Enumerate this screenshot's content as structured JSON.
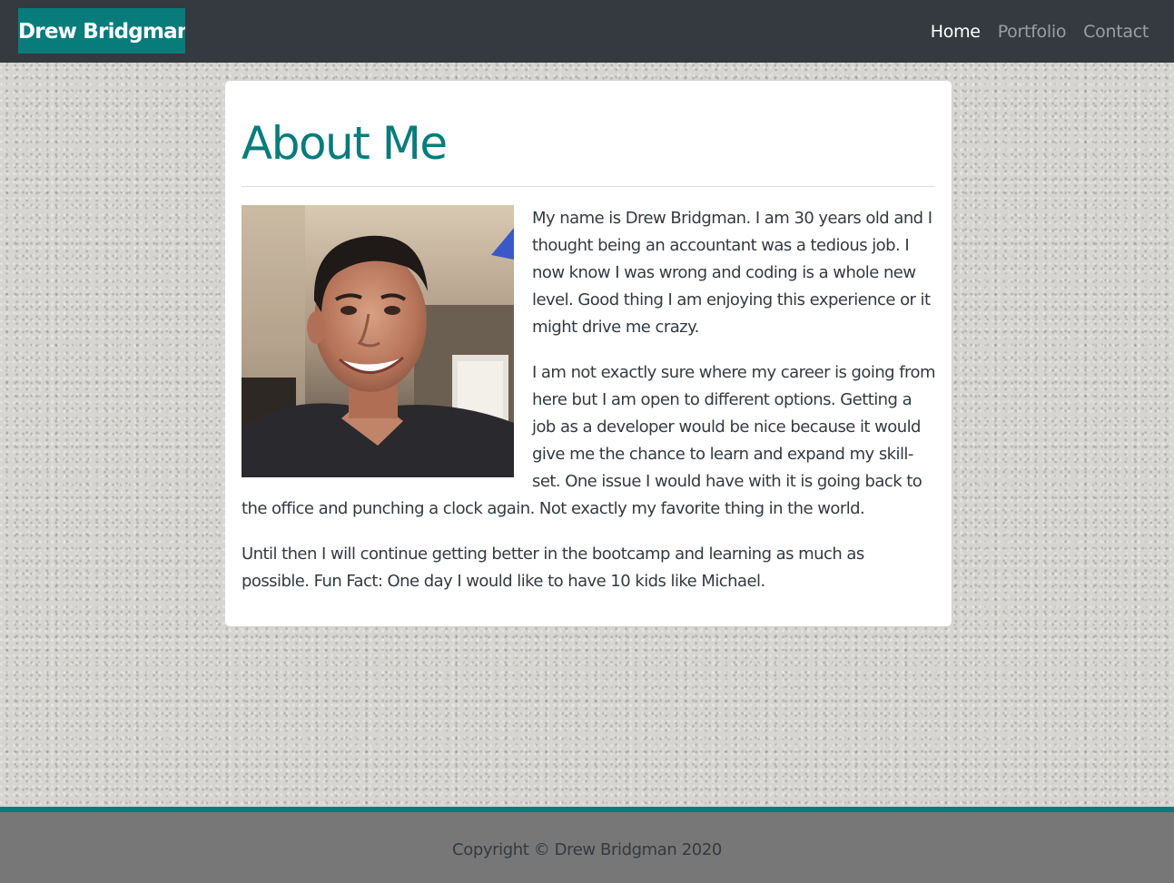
{
  "navbar": {
    "brand": "Drew Bridgman",
    "links": [
      {
        "label": "Home",
        "active": true
      },
      {
        "label": "Portfolio",
        "active": false
      },
      {
        "label": "Contact",
        "active": false
      }
    ]
  },
  "about": {
    "title": "About Me",
    "paragraphs": [
      "My name is Drew Bridgman. I am 30 years old and I thought being an accountant was a tedious job. I now know I was wrong and coding is a whole new level. Good thing I am enjoying this experience or it might drive me crazy.",
      "I am not exactly sure where my career is going from here but I am open to different options. Getting a job as a developer would be nice because it would give me the chance to learn and expand my skill-set. One issue I would have with it is going back to the office and punching a clock again. Not exactly my favorite thing in the world.",
      "Until then I will continue getting better in the bootcamp and learning as much as possible. Fun Fact: One day I would like to have 10 kids like Michael."
    ]
  },
  "footer": {
    "copyright": "Copyright © Drew Bridgman 2020"
  },
  "colors": {
    "accent": "#077c7b",
    "navbar_bg": "#343a40",
    "footer_bg": "#777777",
    "card_bg": "#ffffff"
  }
}
